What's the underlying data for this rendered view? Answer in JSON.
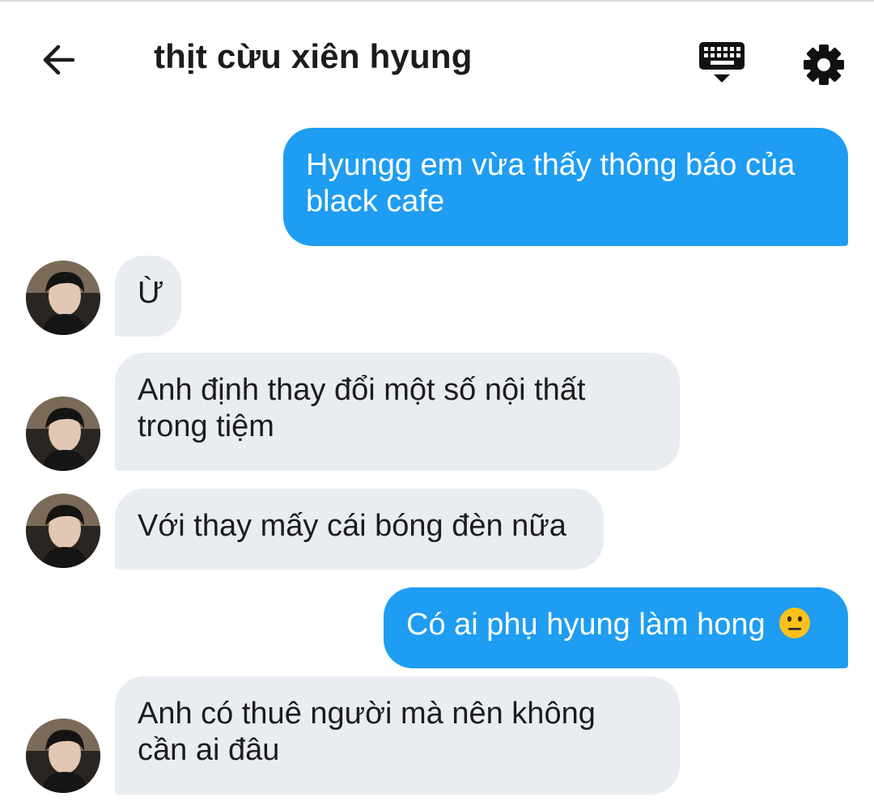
{
  "header": {
    "title": "thịt cừu xiên hyung",
    "back_icon": "arrow-left-icon",
    "keyboard_icon": "keyboard-hide-icon",
    "settings_icon": "gear-icon"
  },
  "colors": {
    "outgoing_bubble": "#1e9df2",
    "incoming_bubble": "#e9ecf0",
    "text_dark": "#1c1c1c"
  },
  "messages": [
    {
      "direction": "outgoing",
      "text": "Hyungg em vừa thấy thông báo của\nblack cafe"
    },
    {
      "direction": "incoming",
      "text": "Ừ"
    },
    {
      "direction": "incoming",
      "text": "Anh định thay đổi một số nội thất\ntrong tiệm"
    },
    {
      "direction": "incoming",
      "text": "Với thay mấy cái bóng đèn nữa"
    },
    {
      "direction": "outgoing",
      "text": "Có ai phụ hyung làm hong",
      "emoji": "neutral-face-emoji"
    },
    {
      "direction": "incoming",
      "text": "Anh có thuê người mà nên không\ncần ai đâu"
    }
  ]
}
